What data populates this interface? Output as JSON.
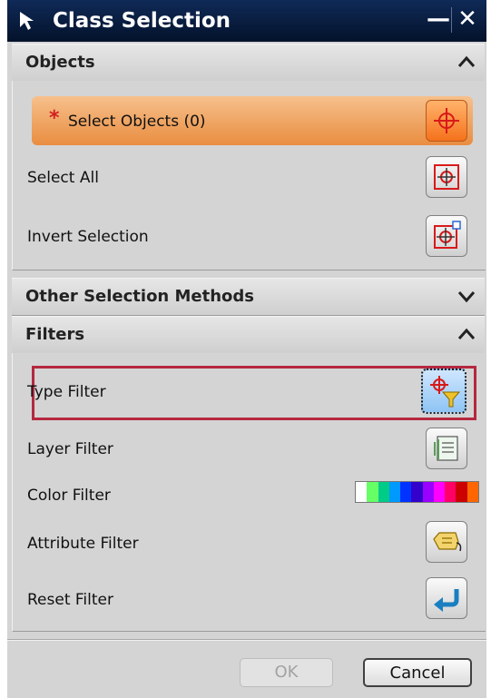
{
  "window": {
    "title": "Class Selection",
    "minimize_glyph": "—",
    "close_glyph": "✕"
  },
  "sections": {
    "objects": {
      "title": "Objects",
      "state": "expanded",
      "items": [
        {
          "label": "Select Objects (0)",
          "required_marker": "*",
          "icon": "crosshair-icon",
          "highlighted": true
        },
        {
          "label": "Select All",
          "icon": "select-all-crosshair-icon"
        },
        {
          "label": "Invert Selection",
          "icon": "invert-selection-icon"
        }
      ]
    },
    "other": {
      "title": "Other Selection Methods",
      "state": "collapsed"
    },
    "filters": {
      "title": "Filters",
      "state": "expanded",
      "items": [
        {
          "label": "Type Filter",
          "icon": "type-filter-funnel-icon",
          "selected": true
        },
        {
          "label": "Layer Filter",
          "icon": "layer-stack-icon"
        },
        {
          "label": "Color Filter",
          "icon": "color-palette-bar"
        },
        {
          "label": "Attribute Filter",
          "icon": "tag-icon"
        },
        {
          "label": "Reset Filter",
          "icon": "reset-arrow-icon"
        }
      ]
    }
  },
  "color_palette": [
    "#ffffff",
    "#66ff66",
    "#00cc88",
    "#0099ff",
    "#0033ff",
    "#3300cc",
    "#9900ff",
    "#ff00ff",
    "#ff0066",
    "#cc0000",
    "#ff6600"
  ],
  "colors": {
    "accent_orange": "#f07a24",
    "selection_outline": "#b5283f",
    "titlebar": "#0f2a57"
  },
  "buttons": {
    "ok": "OK",
    "cancel": "Cancel",
    "ok_enabled": false
  }
}
